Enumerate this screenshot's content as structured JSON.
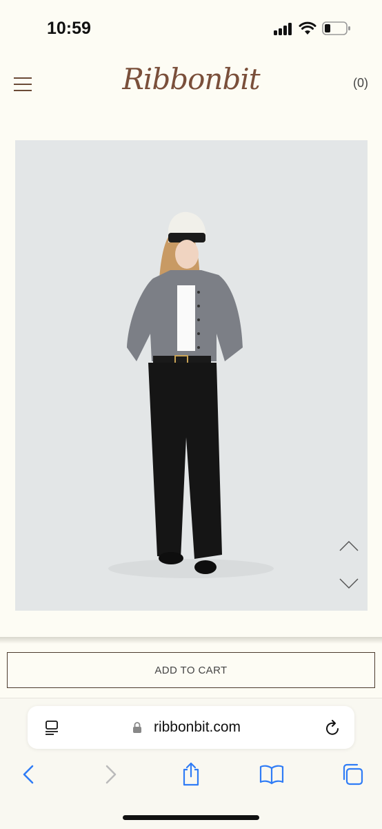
{
  "status_bar": {
    "time": "10:59",
    "icons": [
      "cellular-signal-icon",
      "wifi-icon",
      "battery-icon"
    ]
  },
  "header": {
    "menu_icon": "hamburger-menu-icon",
    "logo_text": "Ribbonbit",
    "cart_count": "(0)"
  },
  "product": {
    "image_description_icon": "product-photo",
    "prev_icon": "chevron-up-icon",
    "next_icon": "chevron-down-icon"
  },
  "actions": {
    "add_to_cart_label": "ADD TO CART"
  },
  "browser": {
    "url": "ribbonbit.com",
    "tabs_icon": "page-menu-icon",
    "lock_icon": "lock-icon",
    "reload_icon": "reload-icon",
    "toolbar": [
      "back-icon",
      "forward-icon",
      "share-icon",
      "bookmarks-icon",
      "tabs-icon"
    ]
  },
  "colors": {
    "background": "#fdfcf4",
    "logo": "#7a4f3a",
    "accent_blue": "#2f7cf6",
    "image_bg": "#e3e6e7"
  }
}
